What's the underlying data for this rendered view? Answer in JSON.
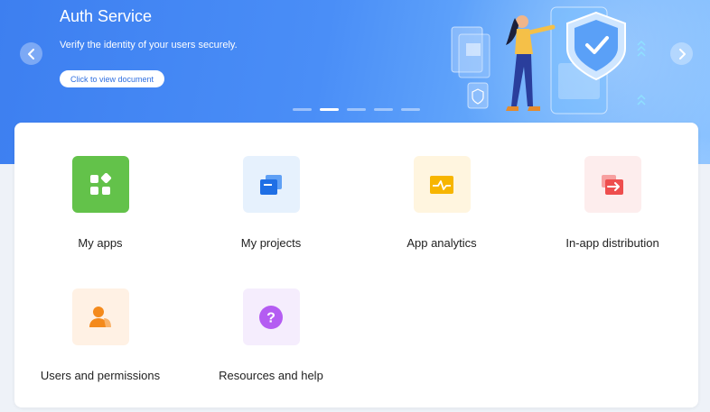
{
  "banner": {
    "title": "Auth Service",
    "subtitle": "Verify the identity of your users securely.",
    "doc_button": "Click to view document",
    "slides": 5,
    "active_slide": 2
  },
  "tiles": [
    {
      "label": "My apps",
      "icon": "apps-grid-icon",
      "bg": "#63c24a"
    },
    {
      "label": "My projects",
      "icon": "projects-stack-icon",
      "bg": "#e6f1fd"
    },
    {
      "label": "App analytics",
      "icon": "analytics-pulse-icon",
      "bg": "#fff5df"
    },
    {
      "label": "In-app distribution",
      "icon": "distribution-arrow-icon",
      "bg": "#fdeded"
    },
    {
      "label": "Users and permissions",
      "icon": "user-group-icon",
      "bg": "#fff1e4"
    },
    {
      "label": "Resources and help",
      "icon": "help-question-icon",
      "bg": "#f5edfd"
    }
  ]
}
